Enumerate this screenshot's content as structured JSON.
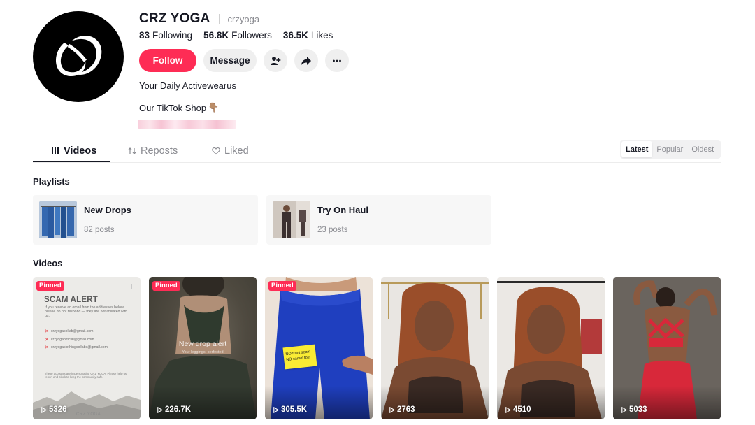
{
  "profile": {
    "name": "CRZ YOGA",
    "handle": "crzyoga",
    "stats": [
      {
        "value": "83",
        "label": "Following"
      },
      {
        "value": "56.8K",
        "label": "Followers"
      },
      {
        "value": "36.5K",
        "label": "Likes"
      }
    ],
    "follow_label": "Follow",
    "message_label": "Message",
    "bio": "Your Daily Activewearus",
    "shop_text": "Our TikTok Shop",
    "shop_emoji": "👇🏽"
  },
  "tabs": [
    {
      "label": "Videos",
      "icon": "grid-icon"
    },
    {
      "label": "Reposts",
      "icon": "repost-icon"
    },
    {
      "label": "Liked",
      "icon": "heart-icon"
    }
  ],
  "sort": [
    "Latest",
    "Popular",
    "Oldest"
  ],
  "playlists_title": "Playlists",
  "playlists": [
    {
      "title": "New Drops",
      "count": "82 posts"
    },
    {
      "title": "Try On Haul",
      "count": "23 posts"
    }
  ],
  "videos_title": "Videos",
  "pinned_label": "Pinned",
  "videos": [
    {
      "views": "5326",
      "pinned": true
    },
    {
      "views": "226.7K",
      "pinned": true
    },
    {
      "views": "305.5K",
      "pinned": true
    },
    {
      "views": "2763",
      "pinned": false
    },
    {
      "views": "4510",
      "pinned": false
    },
    {
      "views": "5033",
      "pinned": false
    }
  ],
  "scam_card": {
    "title": "SCAM ALERT",
    "body": "If you receive an email from the addresses below, please do not respond — they are not affiliated with us.",
    "emails": [
      "crzyogacollab@gmail.com",
      "crzyogaofficial@gmail.com",
      "crzyogaclothingcollabs@gmail.com"
    ],
    "footer": "These accounts are impersonating CRZ YOGA. Please help us report and block to keep the community safe.",
    "mark": "CRZ YOGA"
  },
  "drop_card": {
    "headline": "New drop alert",
    "sub": "Your leggings, perfected"
  },
  "note_card": {
    "line1": "NO front seam",
    "line2": "NO camel toe"
  },
  "colors": {
    "accent": "#fe2c55",
    "text": "#161823",
    "muted": "#8a8b91"
  }
}
